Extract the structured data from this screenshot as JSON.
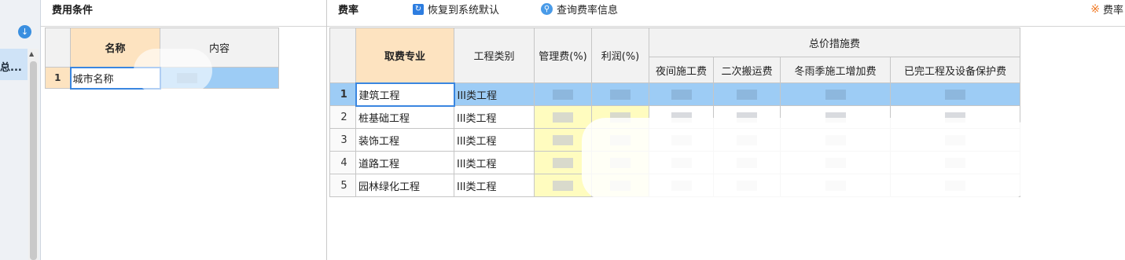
{
  "nav": {
    "collapsed_label": "总..."
  },
  "condition_panel": {
    "title": "费用条件",
    "columns": [
      "名称",
      "内容"
    ],
    "rows": [
      {
        "num": "1",
        "name": "城市名称"
      }
    ]
  },
  "rate_panel": {
    "title": "费率",
    "toolbar": {
      "restore_label": "恢复到系统默认",
      "query_label": "查询费率信息",
      "right_label": "费率"
    },
    "headers": {
      "specialty": "取费专业",
      "category": "工程类别",
      "mgmt": "管理费(%)",
      "profit": "利润(%)",
      "measures_group": "总价措施费",
      "measures": [
        "夜间施工费",
        "二次搬运费",
        "冬雨季施工增加费",
        "已完工程及设备保护费"
      ]
    },
    "rows": [
      {
        "num": "1",
        "specialty": "建筑工程",
        "category": "III类工程"
      },
      {
        "num": "2",
        "specialty": "桩基础工程",
        "category": "III类工程"
      },
      {
        "num": "3",
        "specialty": "装饰工程",
        "category": "III类工程"
      },
      {
        "num": "4",
        "specialty": "道路工程",
        "category": "III类工程"
      },
      {
        "num": "5",
        "specialty": "园林绿化工程",
        "category": "III类工程"
      }
    ]
  },
  "colors": {
    "selection": "#9dccf5",
    "header_highlight": "#fde3c0",
    "editable_yellow": "#fffcbf",
    "accent_blue": "#3a8fe0",
    "accent_orange": "#f07822"
  }
}
